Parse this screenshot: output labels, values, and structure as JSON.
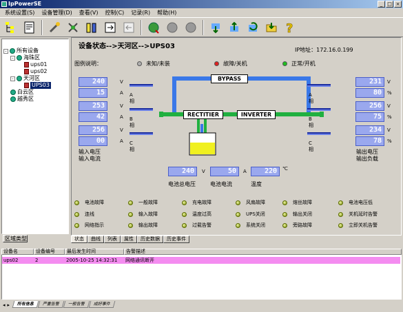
{
  "window": {
    "title": "IpPowerSE"
  },
  "menu": [
    "系统设置(S)",
    "设备管理(D)",
    "查看(V)",
    "控制(C)",
    "记录(R)",
    "帮助(H)"
  ],
  "toolbar": {
    "buttons": [
      "tree-view",
      "report",
      "tools",
      "settings",
      "batteries",
      "export",
      "import",
      "globe-connect",
      "globe-gray",
      "globe-gray-2",
      "download",
      "upload",
      "refresh",
      "folder",
      "help"
    ]
  },
  "tree": {
    "root": "所有设备",
    "nodes": [
      {
        "label": "海珠区",
        "level": 1
      },
      {
        "label": "ups01",
        "level": 2
      },
      {
        "label": "ups02",
        "level": 2
      },
      {
        "label": "天河区",
        "level": 1
      },
      {
        "label": "UPS03",
        "level": 2,
        "selected": true
      },
      {
        "label": "白云区",
        "level": 1
      },
      {
        "label": "越秀区",
        "level": 1
      }
    ],
    "tab": "区域类型"
  },
  "main": {
    "status_title": "设备状态-->天河区-->UPS03",
    "ip_label": "IP地址：172.16.0.199",
    "legend": {
      "title": "图例说明：",
      "items": [
        {
          "label": "未知/未装",
          "color": "#b0b0b0"
        },
        {
          "label": "故障/关机",
          "color": "#e02020"
        },
        {
          "label": "正常/开机",
          "color": "#20c020"
        }
      ]
    },
    "blocks": {
      "bypass": "BYPASS",
      "rectifier": "RECTITIER",
      "inverter": "INVERTER"
    },
    "input": {
      "phases": [
        {
          "voltage": "240",
          "current": "15",
          "phase": "A 相"
        },
        {
          "voltage": "253",
          "current": "42",
          "phase": "B 相"
        },
        {
          "voltage": "256",
          "current": "00",
          "phase": "C 相"
        }
      ],
      "v_unit": "V",
      "a_unit": "A",
      "label1": "输入电压",
      "label2": "输入电流"
    },
    "output": {
      "phases": [
        {
          "voltage": "231",
          "load": "80",
          "phase": "A 相"
        },
        {
          "voltage": "256",
          "load": "75",
          "phase": "B 相"
        },
        {
          "voltage": "234",
          "load": "78",
          "phase": "C 相"
        }
      ],
      "v_unit": "V",
      "pct_unit": "%",
      "label1": "输出电压",
      "label2": "输出负载"
    },
    "battery": {
      "voltage": "240",
      "current": "50",
      "temperature": "220",
      "v_unit": "V",
      "a_unit": "A",
      "t_unit": "℃",
      "voltage_label": "电池总电压",
      "current_label": "电池电流",
      "temp_label": "温度"
    },
    "alarms": [
      [
        "电池故障",
        "一般故障",
        "充电故障",
        "风扇故障",
        "熔丝故障",
        "电池电压低"
      ],
      [
        "连线",
        "输入故障",
        "温度过高",
        "UPS关闭",
        "输出关闭",
        "关机延时告警"
      ],
      [
        "网络指示",
        "输出故障",
        "过载告警",
        "系统关闭",
        "旁路故障",
        "立即关机告警"
      ]
    ],
    "tabs": [
      "状态",
      "曲线",
      "列表",
      "属性",
      "历史数据",
      "历史事件"
    ]
  },
  "events": {
    "headers": [
      "设备名",
      "设备编号",
      "最后发生时间",
      "告警描述"
    ],
    "rows": [
      [
        "ups02",
        "2",
        "2005-10-25 14:32:31",
        "网络通讯断开"
      ]
    ],
    "tabs": [
      "所有信息",
      "严重告警",
      "一般告警",
      "成好事件"
    ]
  },
  "colors": {
    "pipe_blue": "#3a78e8",
    "pipe_green": "#20b040",
    "battery_yellow": "#f0f020",
    "alarm_row": "#f48cf0"
  }
}
